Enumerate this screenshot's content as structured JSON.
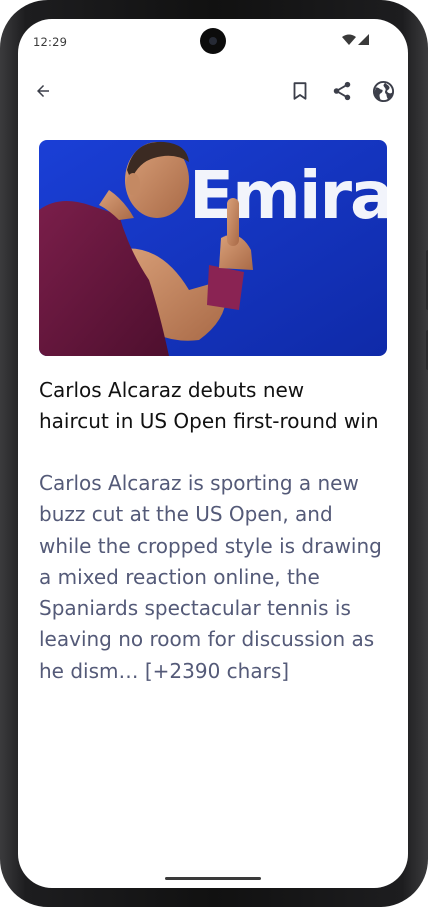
{
  "status_bar": {
    "time": "12:29",
    "wifi_icon": "wifi-icon",
    "signal_icon": "cell-signal-icon"
  },
  "toolbar": {
    "back_icon": "arrow-left-icon",
    "bookmark_icon": "bookmark-icon",
    "share_icon": "share-icon",
    "browser_icon": "globe-icon"
  },
  "article": {
    "image_subject": "tennis player gesturing with raised index finger against a blue banner",
    "image_banner_text": "Emirate",
    "headline": "Carlos Alcaraz debuts new haircut in US Open first-round win",
    "body": "Carlos Alcaraz is sporting a new buzz cut at the US Open, and while the cropped style is drawing a mixed reaction online, the Spaniards spectacular tennis is leaving no room for discussion as he dism… [+2390 chars]"
  },
  "colors": {
    "headline": "#111111",
    "body": "#545a78",
    "icons": "#3c3f4a",
    "banner_blue": "#1233c4"
  }
}
